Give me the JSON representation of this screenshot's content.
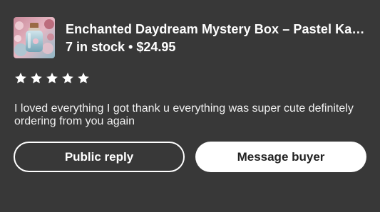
{
  "listing": {
    "thumbnail_icon": "mystery-box-bottle-thumbnail",
    "title": "Enchanted Daydream Mystery Box – Pastel Kawaii",
    "stock": "7 in stock",
    "separator": "•",
    "price": "$24.95"
  },
  "review": {
    "rating": 5,
    "rating_max": 5,
    "text": "I loved everything I got thank u everything was super cute definitely ordering from you again"
  },
  "actions": {
    "public_reply_label": "Public reply",
    "message_buyer_label": "Message buyer"
  },
  "colors": {
    "background": "#383838",
    "text": "#ffffff",
    "button_primary_bg": "#ffffff",
    "button_primary_text": "#222222"
  }
}
